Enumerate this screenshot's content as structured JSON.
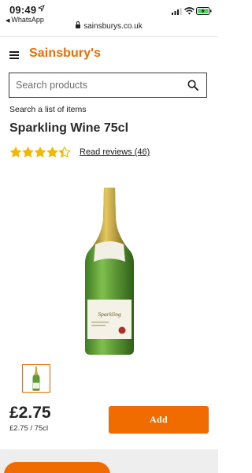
{
  "status_bar": {
    "time": "09:49",
    "back_app": "WhatsApp",
    "url": "sainsburys.co.uk"
  },
  "header": {
    "brand": "Sainsbury's"
  },
  "search": {
    "placeholder": "Search products"
  },
  "links": {
    "list_search": "Search a list of items"
  },
  "product": {
    "title": "Sparkling Wine 75cl",
    "rating": 4.5,
    "rating_max": 5,
    "reviews_label": "Read reviews (46)",
    "price": "£2.75",
    "unit_price": "£2.75 / 75cl",
    "add_label": "Add"
  },
  "colors": {
    "brand_orange": "#f06c00",
    "star_gold": "#f5b800",
    "bottle_green": "#5f9a37"
  }
}
